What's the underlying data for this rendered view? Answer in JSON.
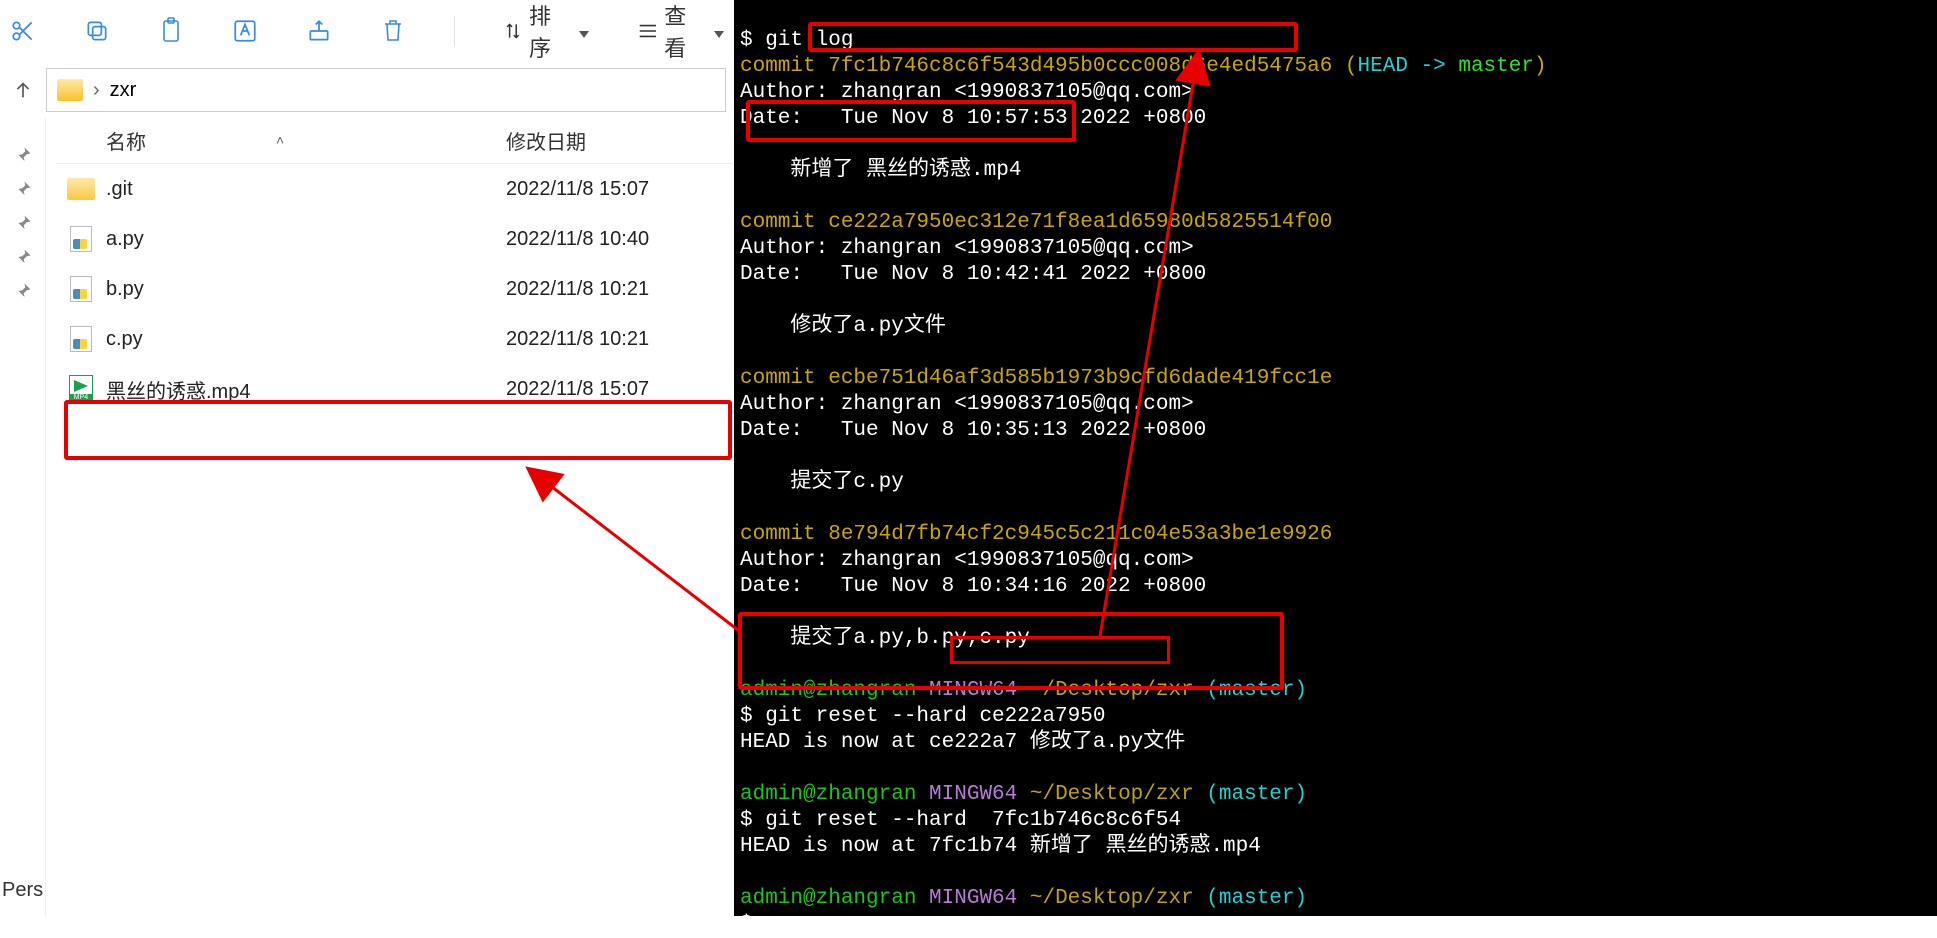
{
  "toolbar": {
    "sort_label": "排序",
    "view_label": "查看"
  },
  "breadcrumb": {
    "folder": "zxr"
  },
  "columns": {
    "name": "名称",
    "date": "修改日期"
  },
  "files": [
    {
      "name": ".git",
      "date": "2022/11/8 15:07",
      "type": "folder"
    },
    {
      "name": "a.py",
      "date": "2022/11/8 10:40",
      "type": "py"
    },
    {
      "name": "b.py",
      "date": "2022/11/8 10:21",
      "type": "py"
    },
    {
      "name": "c.py",
      "date": "2022/11/8 10:21",
      "type": "py"
    },
    {
      "name": "黑丝的诱惑.mp4",
      "date": "2022/11/8 15:07",
      "type": "mp4"
    }
  ],
  "left_bottom": "Pers",
  "term": {
    "l0": "$ git log",
    "l1a": "commit ",
    "l1b": "7fc1b746c8c6f543d495b0ccc008d6e4ed5475a6 (",
    "l1c": "HEAD -> ",
    "l1d": "master",
    "l1e": ")",
    "l2": "Author: zhangran <1990837105@qq.com>",
    "l3": "Date:   Tue Nov 8 10:57:53 2022 +0800",
    "l4": "    新增了 黑丝的诱惑.mp4",
    "l5a": "commit ",
    "l5b": "ce222a7950ec312e71f8ea1d65980d5825514f00",
    "l6": "Author: zhangran <1990837105@qq.com>",
    "l7": "Date:   Tue Nov 8 10:42:41 2022 +0800",
    "l8": "    修改了a.py文件",
    "l9a": "commit ",
    "l9b": "ecbe751d46af3d585b1973b9cfd6dade419fcc1e",
    "l10": "Author: zhangran <1990837105@qq.com>",
    "l11": "Date:   Tue Nov 8 10:35:13 2022 +0800",
    "l12": "    提交了c.py",
    "l13a": "commit ",
    "l13b": "8e794d7fb74cf2c945c5c211c04e53a3be1e9926",
    "l14": "Author: zhangran <1990837105@qq.com>",
    "l15": "Date:   Tue Nov 8 10:34:16 2022 +0800",
    "l16": "    提交了a.py,b.py,c.py",
    "p1a": "admin@zhangran ",
    "p1b": "MINGW64 ",
    "p1c": "~/Desktop/zxr ",
    "p1d": "(master)",
    "r1": "$ git reset --hard ce222a7950",
    "r2": "HEAD is now at ce222a7 修改了a.py文件",
    "r3": "$ git reset --hard  7fc1b746c8c6f54",
    "r4": "HEAD is now at 7fc1b74 新增了 黑丝的诱惑.mp4",
    "end": "$ "
  }
}
